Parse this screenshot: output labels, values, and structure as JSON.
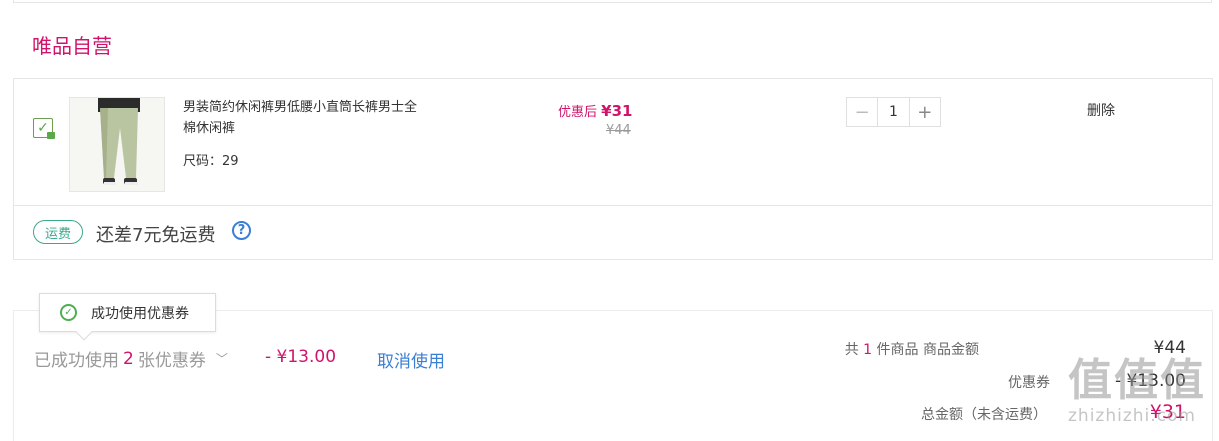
{
  "store": {
    "title": "唯品自营"
  },
  "item": {
    "name": "男装简约休闲裤男低腰小直筒长裤男士全棉休闲裤",
    "size_label": "尺码：29",
    "price_after_label": "优惠后",
    "price_after_value": "¥31",
    "price_original": "¥44",
    "quantity": "1",
    "minus_symbol": "−",
    "plus_symbol": "+",
    "delete_label": "删除",
    "checked": true
  },
  "shipping": {
    "badge": "运费",
    "text": "还差7元免运费",
    "help_symbol": "?"
  },
  "coupon": {
    "toast_text": "成功使用优惠券",
    "used_prefix": "已成功使用",
    "used_count": "2",
    "used_suffix": "张优惠券",
    "used_amount": "- ¥13.00",
    "cancel_label": "取消使用"
  },
  "summary": {
    "count_prefix": "共",
    "count_value": "1",
    "count_suffix": "件商品  商品金额",
    "goods_amount": "¥44",
    "coupon_label": "优惠券",
    "coupon_amount": "- ¥13.00",
    "total_label": "总金额（未含运费）",
    "total_amount": "¥31"
  },
  "watermark": {
    "big": "值值值",
    "small": "zhizhizhi.com"
  },
  "colors": {
    "accent": "#d0146b",
    "link": "#3b7fd4",
    "success": "#4caf50",
    "shipping": "#3aa98a"
  }
}
